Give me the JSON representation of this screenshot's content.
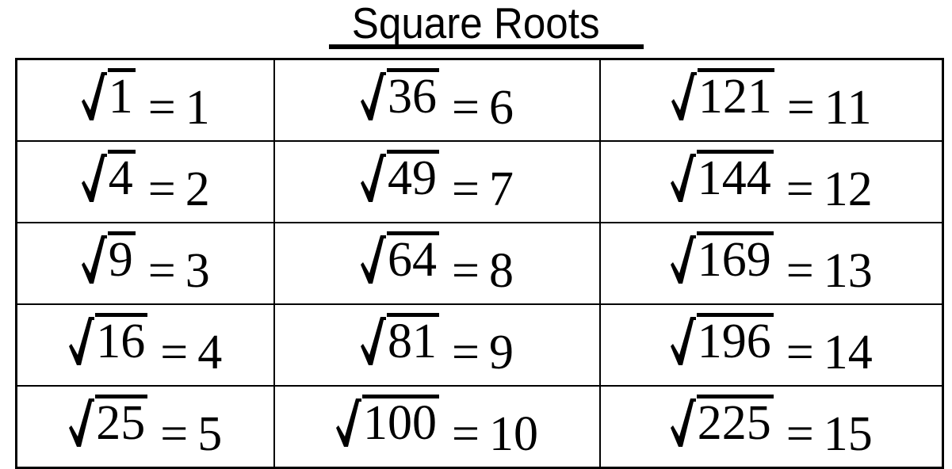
{
  "page": {
    "title": "Square Roots",
    "background_color": "#ffffff",
    "text_color": "#000000",
    "border_color": "#000000"
  },
  "table": {
    "rows": 5,
    "columns": 3,
    "cells": [
      [
        {
          "radicand": "1",
          "equals": "=",
          "result": "1"
        },
        {
          "radicand": "36",
          "equals": "=",
          "result": "6"
        },
        {
          "radicand": "121",
          "equals": "=",
          "result": "11"
        }
      ],
      [
        {
          "radicand": "4",
          "equals": "=",
          "result": "2"
        },
        {
          "radicand": "49",
          "equals": "=",
          "result": "7"
        },
        {
          "radicand": "144",
          "equals": "=",
          "result": "12"
        }
      ],
      [
        {
          "radicand": "9",
          "equals": "=",
          "result": "3"
        },
        {
          "radicand": "64",
          "equals": "=",
          "result": "8"
        },
        {
          "radicand": "169",
          "equals": "=",
          "result": "13"
        }
      ],
      [
        {
          "radicand": "16",
          "equals": "=",
          "result": "4"
        },
        {
          "radicand": "81",
          "equals": "=",
          "result": "9"
        },
        {
          "radicand": "196",
          "equals": "=",
          "result": "14"
        }
      ],
      [
        {
          "radicand": "25",
          "equals": "=",
          "result": "5"
        },
        {
          "radicand": "100",
          "equals": "=",
          "result": "10"
        },
        {
          "radicand": "225",
          "equals": "=",
          "result": "15"
        }
      ]
    ]
  }
}
